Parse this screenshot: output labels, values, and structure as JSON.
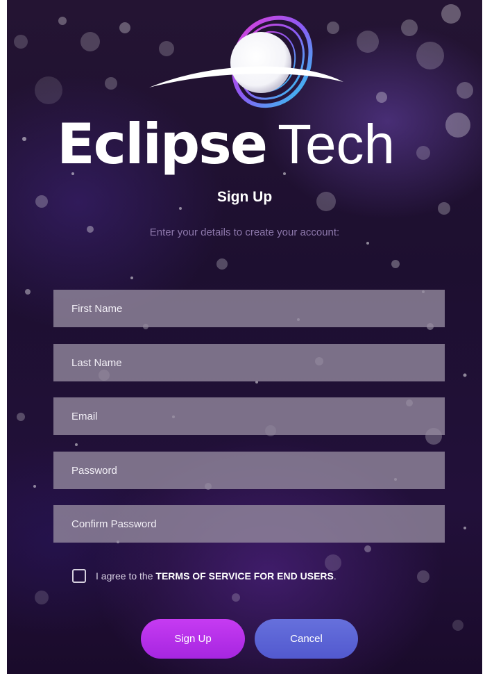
{
  "brand": {
    "name_bold": "Eclipse",
    "name_light": "Tech",
    "logo_icon": "eclipse-planet-logo-icon"
  },
  "form": {
    "title": "Sign Up",
    "subtitle": "Enter your details to create your account:",
    "fields": {
      "first_name": {
        "placeholder": "First Name",
        "value": ""
      },
      "last_name": {
        "placeholder": "Last Name",
        "value": ""
      },
      "email": {
        "placeholder": "Email",
        "value": ""
      },
      "password": {
        "placeholder": "Password",
        "value": ""
      },
      "confirm_password": {
        "placeholder": "Confirm Password",
        "value": ""
      }
    },
    "agree": {
      "checked": false,
      "prefix": "I agree to the",
      "terms_link": "TERMS OF SERVICE FOR END USERS",
      "suffix": "."
    },
    "buttons": {
      "signup_label": "Sign Up",
      "cancel_label": "Cancel"
    }
  },
  "colors": {
    "signup_button": "#b430e8",
    "cancel_button": "#5a62d6",
    "field_background": "#968ca0",
    "subtitle_text": "#8d78ab",
    "background": "#1f1030"
  }
}
